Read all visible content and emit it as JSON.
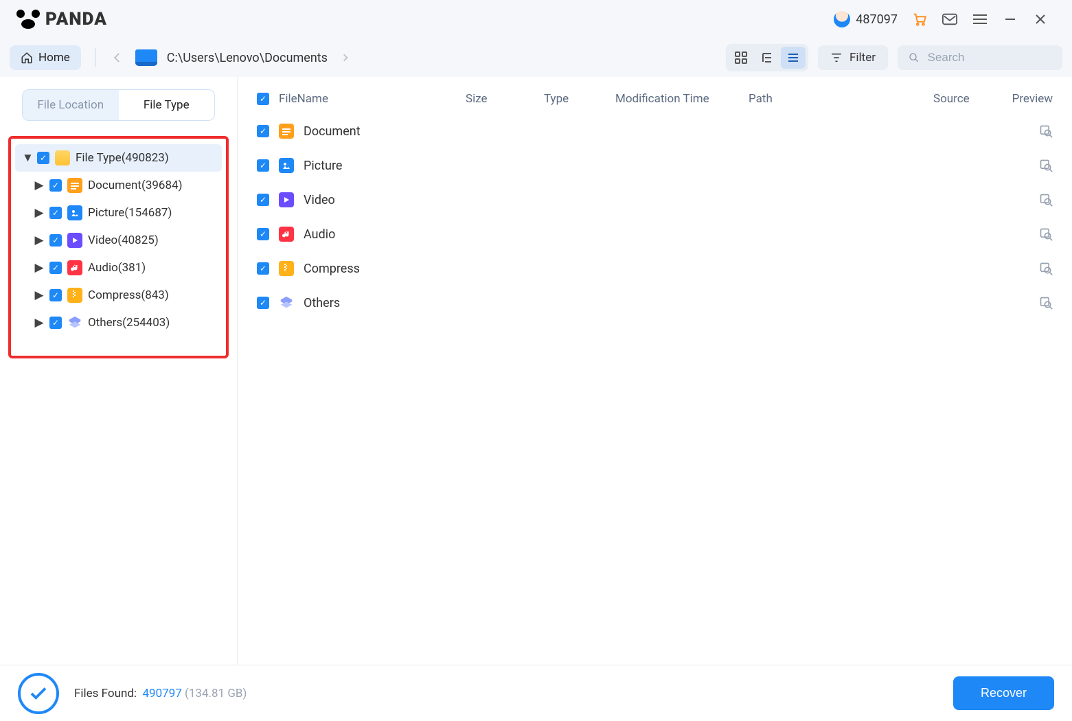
{
  "app": {
    "name": "PANDA",
    "user_id": "487097"
  },
  "toolbar": {
    "home": "Home",
    "path": "C:\\Users\\Lenovo\\Documents",
    "filter": "Filter",
    "search_placeholder": "Search"
  },
  "sidebar": {
    "tabs": {
      "location": "File Location",
      "type": "File Type"
    },
    "root": {
      "label": "File Type",
      "count": "(490823)"
    },
    "items": [
      {
        "label": "Document",
        "count": "(39684)",
        "icon": "doc"
      },
      {
        "label": "Picture",
        "count": "(154687)",
        "icon": "pic"
      },
      {
        "label": "Video",
        "count": "(40825)",
        "icon": "vid"
      },
      {
        "label": "Audio",
        "count": "(381)",
        "icon": "aud"
      },
      {
        "label": "Compress",
        "count": "(843)",
        "icon": "zip"
      },
      {
        "label": "Others",
        "count": "(254403)",
        "icon": "oth"
      }
    ]
  },
  "columns": {
    "name": "FileName",
    "size": "Size",
    "type": "Type",
    "mod": "Modification Time",
    "path": "Path",
    "source": "Source",
    "preview": "Preview"
  },
  "rows": [
    {
      "name": "Document",
      "icon": "doc"
    },
    {
      "name": "Picture",
      "icon": "pic"
    },
    {
      "name": "Video",
      "icon": "vid"
    },
    {
      "name": "Audio",
      "icon": "aud"
    },
    {
      "name": "Compress",
      "icon": "zip"
    },
    {
      "name": "Others",
      "icon": "oth"
    }
  ],
  "status": {
    "label": "Files Found:",
    "count": "490797",
    "size": "(134.81 GB)",
    "recover": "Recover"
  }
}
